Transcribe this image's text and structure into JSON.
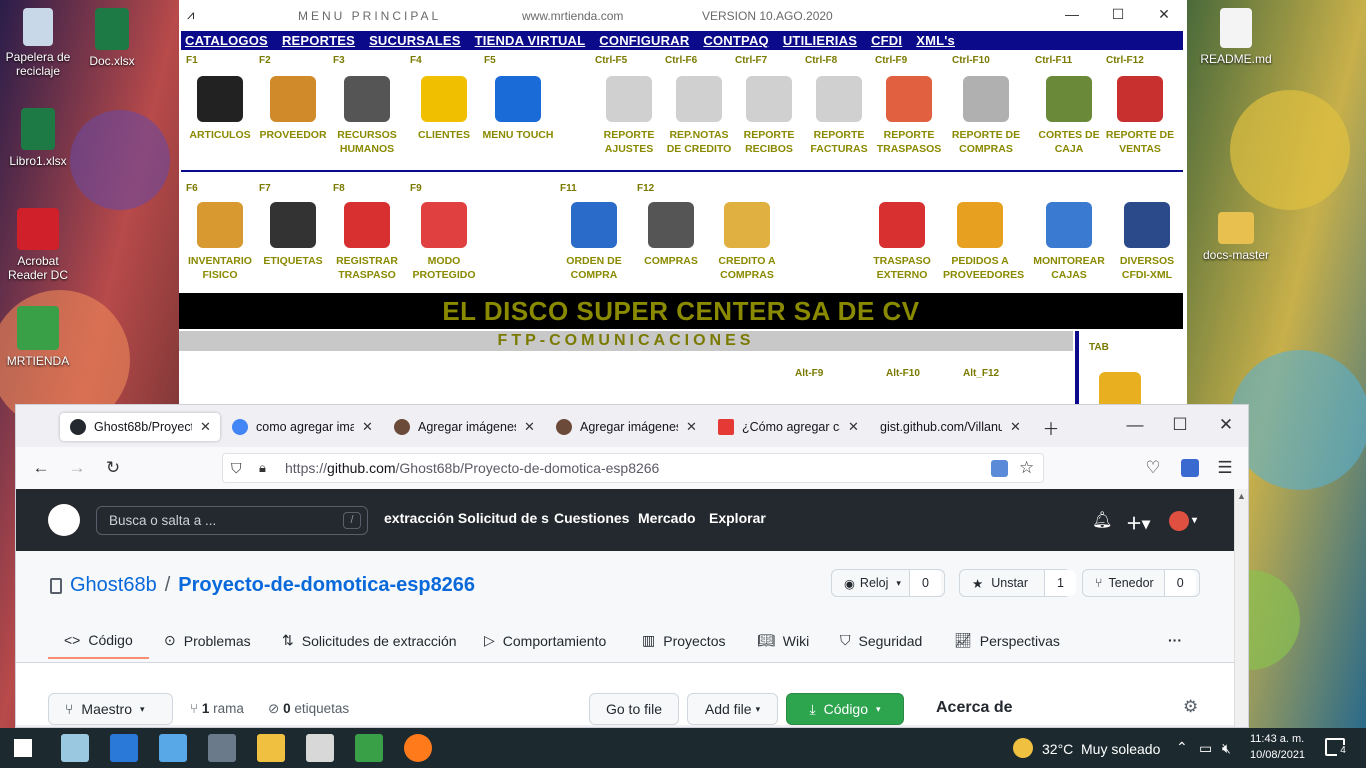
{
  "desktop": {
    "icons": [
      {
        "label": "Papelera de reciclaje",
        "icon": "recycle-bin-icon"
      },
      {
        "label": "Doc.xlsx",
        "icon": "excel-icon"
      },
      {
        "label": "Libro1.xlsx",
        "icon": "excel-icon"
      },
      {
        "label": "Acrobat Reader DC",
        "icon": "pdf-icon"
      },
      {
        "label": "MRTIENDA",
        "icon": "mrtienda-icon"
      },
      {
        "label": "README.md",
        "icon": "file-icon"
      },
      {
        "label": "docs-master",
        "icon": "folder-icon"
      }
    ]
  },
  "menu_principal": {
    "title": "MENU PRINCIPAL",
    "site": "www.mrtienda.com",
    "version": "VERSION  10.AGO.2020",
    "menu": [
      "CATALOGOS",
      "REPORTES",
      "SUCURSALES",
      "TIENDA VIRTUAL",
      "CONFIGURAR",
      "CONTPAQ",
      "UTILIERIAS",
      "CFDI",
      "XML's"
    ],
    "row1": [
      {
        "key": "F1",
        "label": "ARTICULOS",
        "color": "#222222"
      },
      {
        "key": "F2",
        "label": "PROVEEDOR",
        "color": "#d08a2a"
      },
      {
        "key": "F3",
        "label": "RECURSOS HUMANOS",
        "color": "#555555"
      },
      {
        "key": "F4",
        "label": "CLIENTES",
        "color": "#f0c000"
      },
      {
        "key": "F5",
        "label": "MENU TOUCH",
        "color": "#1a6ad8"
      },
      {
        "key": "Ctrl-F5",
        "label": "REPORTE AJUSTES",
        "color": "#d0d0d0"
      },
      {
        "key": "Ctrl-F6",
        "label": "REP.NOTAS DE CREDITO",
        "color": "#d0d0d0"
      },
      {
        "key": "Ctrl-F7",
        "label": "REPORTE RECIBOS",
        "color": "#d0d0d0"
      },
      {
        "key": "Ctrl-F8",
        "label": "REPORTE FACTURAS",
        "color": "#d0d0d0"
      },
      {
        "key": "Ctrl-F9",
        "label": "REPORTE TRASPASOS",
        "color": "#e06040"
      },
      {
        "key": "Ctrl-F10",
        "label": "REPORTE DE COMPRAS",
        "color": "#b0b0b0"
      },
      {
        "key": "Ctrl-F11",
        "label": "CORTES DE CAJA",
        "color": "#6a8a3a"
      },
      {
        "key": "Ctrl-F12",
        "label": "REPORTE DE VENTAS",
        "color": "#c83030"
      }
    ],
    "row2": [
      {
        "key": "F6",
        "label": "INVENTARIO FISICO",
        "color": "#d89a30"
      },
      {
        "key": "F7",
        "label": "ETIQUETAS",
        "color": "#333333"
      },
      {
        "key": "F8",
        "label": "REGISTRAR TRASPASO",
        "color": "#d83030"
      },
      {
        "key": "F9",
        "label": "MODO PROTEGIDO",
        "color": "#e04040"
      },
      {
        "key": "F11",
        "label": "ORDEN DE COMPRA",
        "color": "#2a6ac8"
      },
      {
        "key": "F12",
        "label": "COMPRAS",
        "color": "#555555"
      },
      {
        "key": "",
        "label": "CREDITO A COMPRAS",
        "color": "#e0b040"
      },
      {
        "key": "",
        "label": "TRASPASO EXTERNO",
        "color": "#d83030"
      },
      {
        "key": "",
        "label": "PEDIDOS A PROVEEDORES",
        "color": "#e8a020"
      },
      {
        "key": "",
        "label": "MONITOREAR CAJAS",
        "color": "#3a7ad0"
      },
      {
        "key": "",
        "label": "DIVERSOS CFDI-XML",
        "color": "#2a4a8a"
      }
    ],
    "company": "EL DISCO SUPER CENTER SA DE CV",
    "ftp": "FTP-COMUNICACIONES",
    "tab_label": "TAB",
    "ftp_keys": [
      "Alt-F9",
      "Alt-F10",
      "Alt_F12"
    ]
  },
  "browser": {
    "tabs": [
      {
        "label": "Ghost68b/Proyecto-",
        "fav": "#24292f"
      },
      {
        "label": "como agregar image",
        "fav": "#4285f4"
      },
      {
        "label": "Agregar imágenes a",
        "fav": "#6b4a3a"
      },
      {
        "label": "Agregar imágenes a",
        "fav": "#6b4a3a"
      },
      {
        "label": "¿Cómo agregar cap",
        "fav": "#e53935"
      },
      {
        "label": "gist.github.com/Villanu",
        "fav": "#f0f0f4"
      }
    ],
    "url_prefix": "https://",
    "url_host": "github.com",
    "url_path": "/Ghost68b/Proyecto-de-domotica-esp8266"
  },
  "github": {
    "search_placeholder": "Busca o salta a ...",
    "search_key": "/",
    "nav": [
      "extracción Solicitud de s",
      "Cuestiones",
      "Mercado",
      "Explorar"
    ],
    "owner": "Ghost68b",
    "separator": "/",
    "repo": "Proyecto-de-domotica-esp8266",
    "watch_label": "Reloj",
    "watch_count": "0",
    "star_label": "Unstar",
    "star_count": "1",
    "fork_label": "Tenedor",
    "fork_count": "0",
    "tabs": [
      "Código",
      "Problemas",
      "Solicitudes de extracción",
      "Comportamiento",
      "Proyectos",
      "Wiki",
      "Seguridad",
      "Perspectivas"
    ],
    "more": "···",
    "branch_label": "Maestro",
    "branches_count": "1",
    "branches_label": "rama",
    "tags_count": "0",
    "tags_label": "etiquetas",
    "go_to_file": "Go to file",
    "add_file": "Add file",
    "code_button": "Código",
    "about": "Acerca de"
  },
  "taskbar": {
    "weather_temp": "32°C",
    "weather_text": "Muy soleado",
    "time": "11:43 a. m.",
    "date": "10/08/2021",
    "notifications": "4"
  }
}
